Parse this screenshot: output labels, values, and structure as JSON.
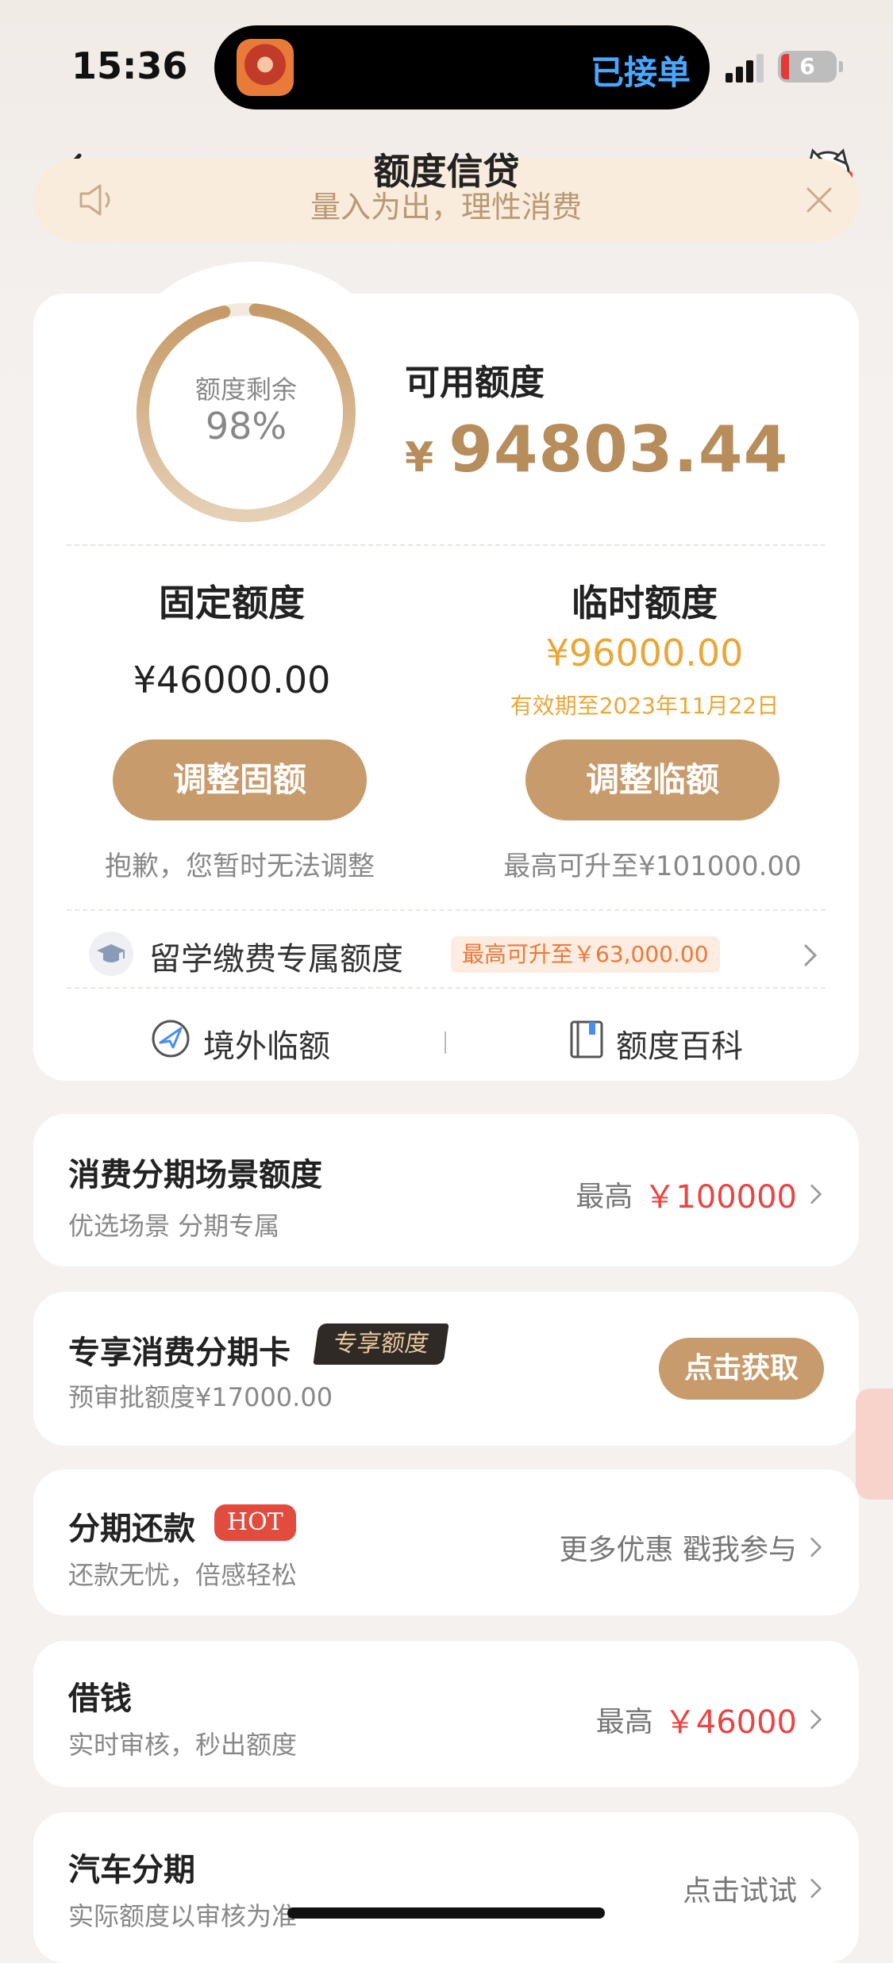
{
  "status_bar": {
    "time": "15:36",
    "island_status": "已接单",
    "battery": "6"
  },
  "header": {
    "title": "额度信贷",
    "notice": "量入为出，理性消费"
  },
  "credit": {
    "ring_label": "额度剩余",
    "ring_percent": "98%",
    "ring_fraction": 0.98,
    "available_label": "可用额度",
    "available_currency": "¥",
    "available_amount": "94803.44",
    "fixed": {
      "title": "固定额度",
      "amount": "¥46000.00",
      "button": "调整固额",
      "note": "抱歉，您暂时无法调整"
    },
    "temporary": {
      "title": "临时额度",
      "amount": "¥96000.00",
      "valid_until": "有效期至2023年11月22日",
      "button": "调整临额",
      "note": "最高可升至¥101000.00"
    },
    "study_abroad": {
      "label": "留学缴费专属额度",
      "badge": "最高可升至￥63,000.00"
    },
    "links": {
      "overseas": "境外临额",
      "wiki": "额度百科"
    }
  },
  "rows": {
    "consumer_installment": {
      "title": "消费分期场景额度",
      "subtitle": "优选场景 分期专属",
      "prefix": "最高",
      "amount": "￥100000"
    },
    "exclusive_card": {
      "title": "专享消费分期卡",
      "badge": "专享额度",
      "subtitle": "预审批额度¥17000.00",
      "button": "点击获取"
    },
    "installment_repay": {
      "title": "分期还款",
      "badge": "HOT",
      "subtitle": "还款无忧，倍感轻松",
      "right_text": "更多优惠 戳我参与"
    },
    "borrow": {
      "title": "借钱",
      "subtitle": "实时审核，秒出额度",
      "prefix": "最高",
      "amount": "￥46000"
    },
    "car_installment": {
      "title": "汽车分期",
      "subtitle": "实际额度以审核为准",
      "right_text": "点击试试"
    }
  },
  "colors": {
    "gold": "#c79b6c",
    "amount_gold": "#b68d5b",
    "orange": "#e9a73a",
    "red": "#e94545"
  }
}
